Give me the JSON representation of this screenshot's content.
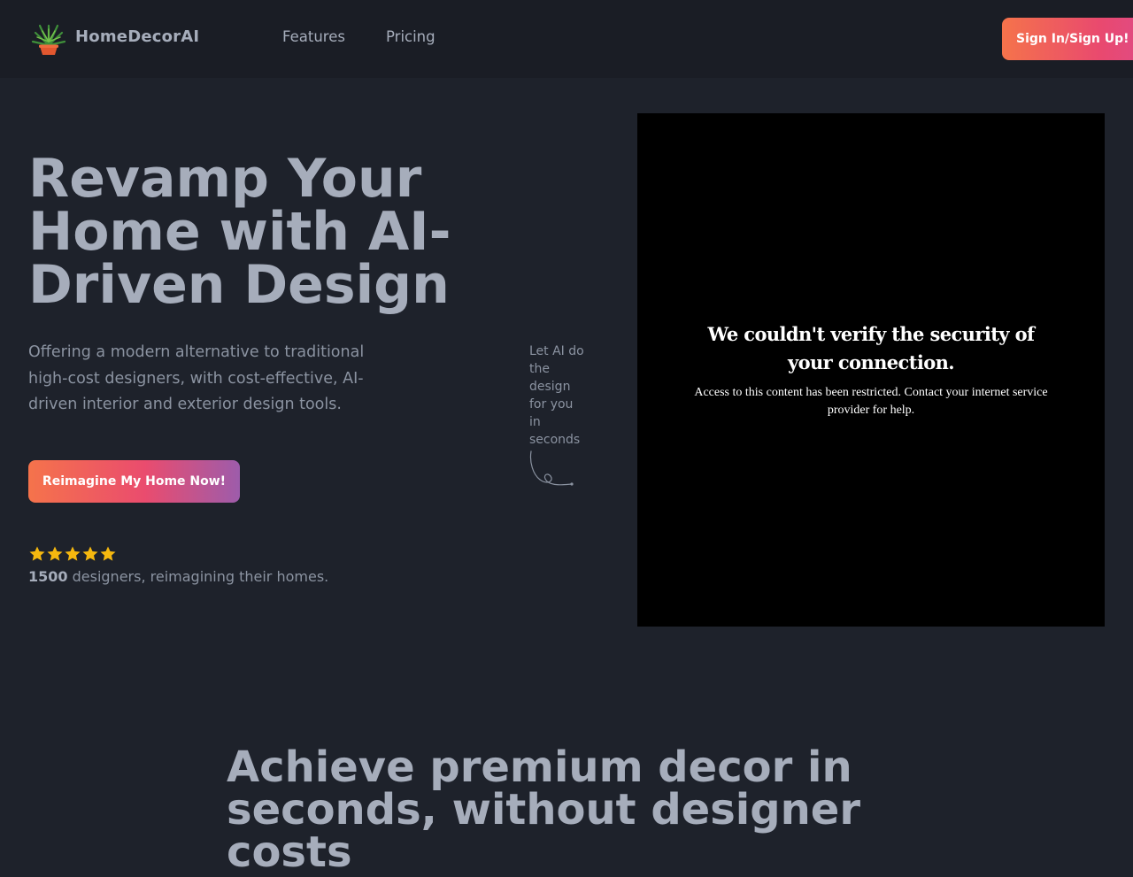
{
  "brand": {
    "name": "HomeDecorAI",
    "logo_icon": "potted-plant-icon"
  },
  "nav": {
    "links": [
      "Features",
      "Pricing"
    ],
    "signin_label": "Sign In/Sign Up!"
  },
  "hero": {
    "title": "Revamp Your Home with AI-Driven Design",
    "subtitle": "Offering a modern alternative to traditional high-cost designers, with cost-effective, AI-driven interior and exterior design tools.",
    "cta_label": "Reimagine My Home Now!",
    "rating": {
      "stars": 5,
      "count": "1500",
      "text": " designers, reimagining their homes."
    },
    "side_note": "Let AI do the design for you in seconds"
  },
  "media": {
    "heading": "We couldn't verify the security of your connection.",
    "body": "Access to this content has been restricted. Contact your internet service provider for help."
  },
  "section": {
    "title": "Achieve premium decor in seconds, without designer costs"
  },
  "colors": {
    "background": "#1e222b",
    "navbar": "#1a1d25",
    "text_primary": "#a6adbb",
    "text_muted": "#8b93a1",
    "star": "#f5b80f",
    "gradient_start": "#f5734b",
    "gradient_mid": "#ea4c6e",
    "gradient_end": "#9d5cab"
  }
}
